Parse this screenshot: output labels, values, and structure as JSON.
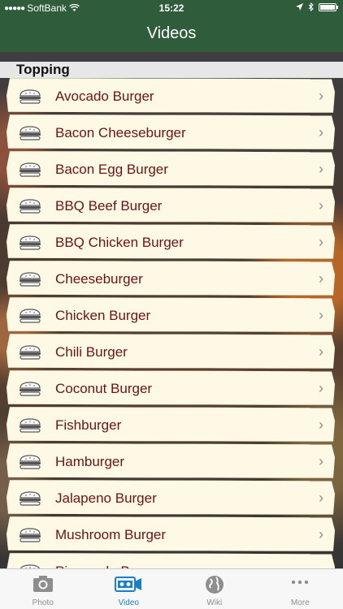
{
  "status_bar": {
    "carrier": "SoftBank",
    "time": "15:22"
  },
  "nav": {
    "title": "Videos"
  },
  "section": {
    "title": "Topping"
  },
  "items": [
    {
      "label": "Avocado Burger"
    },
    {
      "label": "Bacon Cheeseburger"
    },
    {
      "label": "Bacon Egg Burger"
    },
    {
      "label": "BBQ Beef Burger"
    },
    {
      "label": "BBQ Chicken Burger"
    },
    {
      "label": "Cheeseburger"
    },
    {
      "label": "Chicken Burger"
    },
    {
      "label": "Chili Burger"
    },
    {
      "label": "Coconut Burger"
    },
    {
      "label": "Fishburger"
    },
    {
      "label": "Hamburger"
    },
    {
      "label": "Jalapeno Burger"
    },
    {
      "label": "Mushroom Burger"
    },
    {
      "label": "Pineapple Burger"
    }
  ],
  "row_icon": "burger-icon",
  "row_accessory": "chevron-right-icon",
  "tabbar": {
    "tabs": [
      {
        "label": "Photo",
        "icon": "camera-icon",
        "active": false
      },
      {
        "label": "Video",
        "icon": "video-camera-icon",
        "active": true
      },
      {
        "label": "Wiki",
        "icon": "globe-icon",
        "active": false
      },
      {
        "label": "More",
        "icon": "more-icon",
        "active": false
      }
    ]
  },
  "colors": {
    "nav_bar": "#2f5c3a",
    "row_background": "#fdf9e4",
    "row_text": "#6b1414",
    "tab_active": "#1a7ec6",
    "tab_inactive": "#8e8e8e"
  }
}
